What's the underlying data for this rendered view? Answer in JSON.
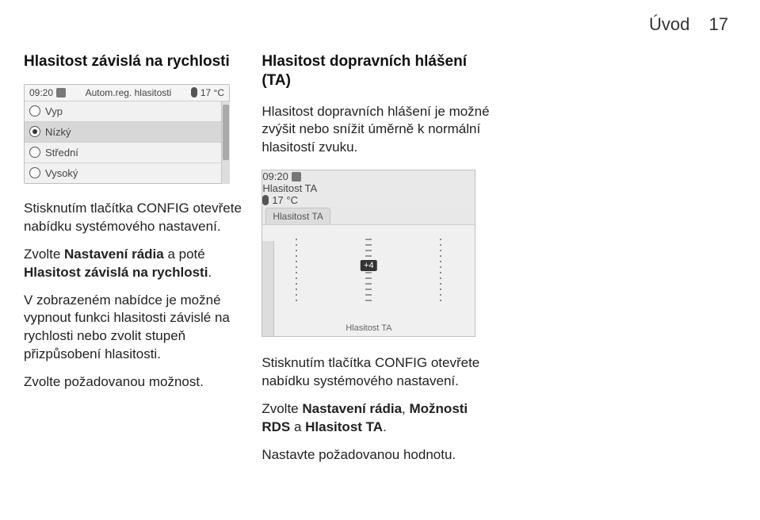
{
  "header": {
    "title": "Úvod",
    "page_num": "17"
  },
  "col1": {
    "heading": "Hlasitost závislá na rychlosti",
    "screenshot": {
      "time": "09:20",
      "title": "Autom.reg. hlasitosti",
      "temp": "17 °C",
      "options": [
        {
          "label": "Vyp",
          "selected": false
        },
        {
          "label": "Nízký",
          "selected": true
        },
        {
          "label": "Střední",
          "selected": false
        },
        {
          "label": "Vysoký",
          "selected": false
        }
      ]
    },
    "p1": "Stisknutím tlačítka CONFIG otevřete nabídku systémového nastavení.",
    "p2_a": "Zvolte ",
    "p2_b": "Nastavení rádia",
    "p2_c": " a poté ",
    "p2_d": "Hlasitost závislá na rychlosti",
    "p2_e": ".",
    "p3": "V zobrazeném nabídce je možné vypnout funkci hlasitosti závislé na rychlosti nebo zvolit stupeň přizpůsobení hlasitosti.",
    "p4": "Zvolte požadovanou možnost."
  },
  "col2": {
    "heading": "Hlasitost dopravních hlášení (TA)",
    "p1": "Hlasitost dopravních hlášení je možné zvýšit nebo snížit úměrně k normální hlasitostí zvuku.",
    "screenshot": {
      "time": "09:20",
      "title": "Hlasitost TA",
      "temp": "17 °C",
      "tab": "Hlasitost TA",
      "value": "+4",
      "footer": "Hlasitost TA"
    },
    "p2": "Stisknutím tlačítka CONFIG otevřete nabídku systémového nastavení.",
    "p3_a": "Zvolte ",
    "p3_b": "Nastavení rádia",
    "p3_c": ", ",
    "p3_d": "Možnosti RDS",
    "p3_e": " a ",
    "p3_f": "Hlasitost TA",
    "p3_g": ".",
    "p4": "Nastavte požadovanou hodnotu."
  }
}
